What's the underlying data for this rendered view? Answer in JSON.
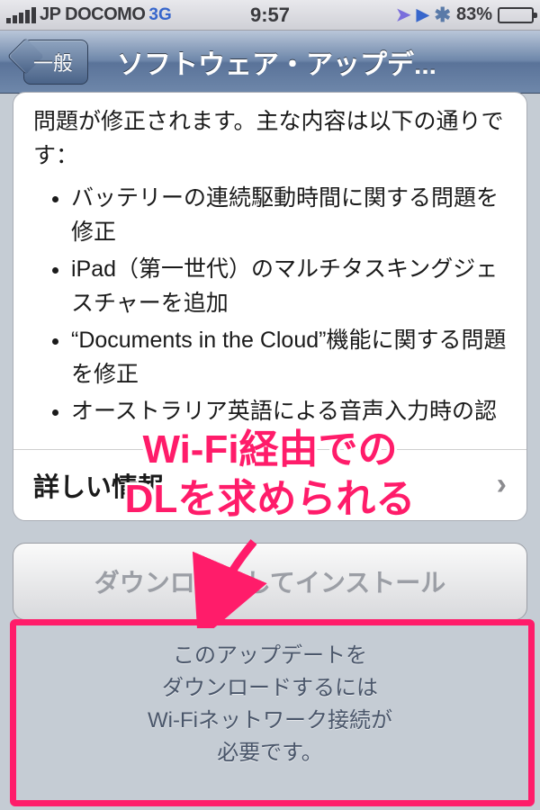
{
  "status": {
    "carrier": "JP DOCOMO",
    "network": "3G",
    "time": "9:57",
    "battery_pct": "83%"
  },
  "nav": {
    "back_label": "一般",
    "title": "ソフトウェア・アップデ..."
  },
  "update": {
    "intro": "問題が修正されます。主な内容は以下の通りです：",
    "bullets": [
      "バッテリーの連続駆動時間に関する問題を修正",
      "iPad（第一世代）のマルチタスキングジェスチャーを追加",
      "“Documents in the Cloud”機能に関する問題を修正",
      "オーストラリア英語による音声入力時の認"
    ],
    "more_label": "詳しい情報",
    "download_label": "ダウンロードしてインストール",
    "hint_l1": "このアップデートを",
    "hint_l2": "ダウンロードするには",
    "hint_l3": "Wi-Fiネットワーク接続が",
    "hint_l4": "必要です。"
  },
  "annotation": {
    "line1": "Wi-Fi経由での",
    "line2": "DLを求められる"
  }
}
